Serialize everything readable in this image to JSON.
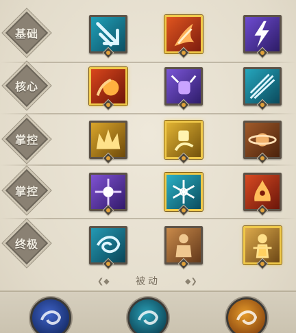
{
  "tiers": [
    {
      "label": "基础"
    },
    {
      "label": "核心"
    },
    {
      "label": "掌控"
    },
    {
      "label": "掌控"
    },
    {
      "label": "终极"
    }
  ],
  "skills": [
    [
      {
        "icon": "ice-arrow-icon",
        "colors": [
          "#1fa0b8",
          "#0e4f63"
        ],
        "selected": false
      },
      {
        "icon": "fire-claw-icon",
        "colors": [
          "#e0551f",
          "#7d1d0e"
        ],
        "selected": true
      },
      {
        "icon": "lightning-icon",
        "colors": [
          "#6d4bd0",
          "#2d1c66"
        ],
        "selected": false
      }
    ],
    [
      {
        "icon": "fireball-icon",
        "colors": [
          "#d8461c",
          "#6e1508"
        ],
        "selected": true
      },
      {
        "icon": "lightning-fist-icon",
        "colors": [
          "#7a55d6",
          "#2f1d6b"
        ],
        "selected": false
      },
      {
        "icon": "ice-shards-icon",
        "colors": [
          "#25a6bd",
          "#0b4a5c"
        ],
        "selected": false
      }
    ],
    [
      {
        "icon": "crown-icon",
        "colors": [
          "#d9a52a",
          "#6e4a0b"
        ],
        "selected": false
      },
      {
        "icon": "spirit-hand-icon",
        "colors": [
          "#e0b232",
          "#74520c"
        ],
        "selected": true
      },
      {
        "icon": "orbit-icon",
        "colors": [
          "#a15a2a",
          "#4b230c"
        ],
        "selected": false
      }
    ],
    [
      {
        "icon": "arcane-burst-icon",
        "colors": [
          "#7f52d2",
          "#321a6a"
        ],
        "selected": false
      },
      {
        "icon": "snowflake-icon",
        "colors": [
          "#2ab0c5",
          "#0c4d5e"
        ],
        "selected": true
      },
      {
        "icon": "fire-spirit-icon",
        "colors": [
          "#d84a22",
          "#6b160a"
        ],
        "selected": false
      }
    ],
    [
      {
        "icon": "blizzard-icon",
        "colors": [
          "#2499b3",
          "#0b4557"
        ],
        "selected": false
      },
      {
        "icon": "fire-avatar-icon",
        "colors": [
          "#c98a4a",
          "#62381a"
        ],
        "selected": false
      },
      {
        "icon": "golden-avatar-icon",
        "colors": [
          "#dca94a",
          "#6c4716"
        ],
        "selected": true
      }
    ]
  ],
  "passive": {
    "title": "被动",
    "orbs": [
      {
        "icon": "arcane-orb-icon",
        "colors": [
          "#3f63c8",
          "#152b66"
        ]
      },
      {
        "icon": "frost-orb-icon",
        "colors": [
          "#2a9fb6",
          "#0d4455"
        ]
      },
      {
        "icon": "flame-orb-icon",
        "colors": [
          "#e59a2a",
          "#8a4710"
        ]
      }
    ]
  }
}
